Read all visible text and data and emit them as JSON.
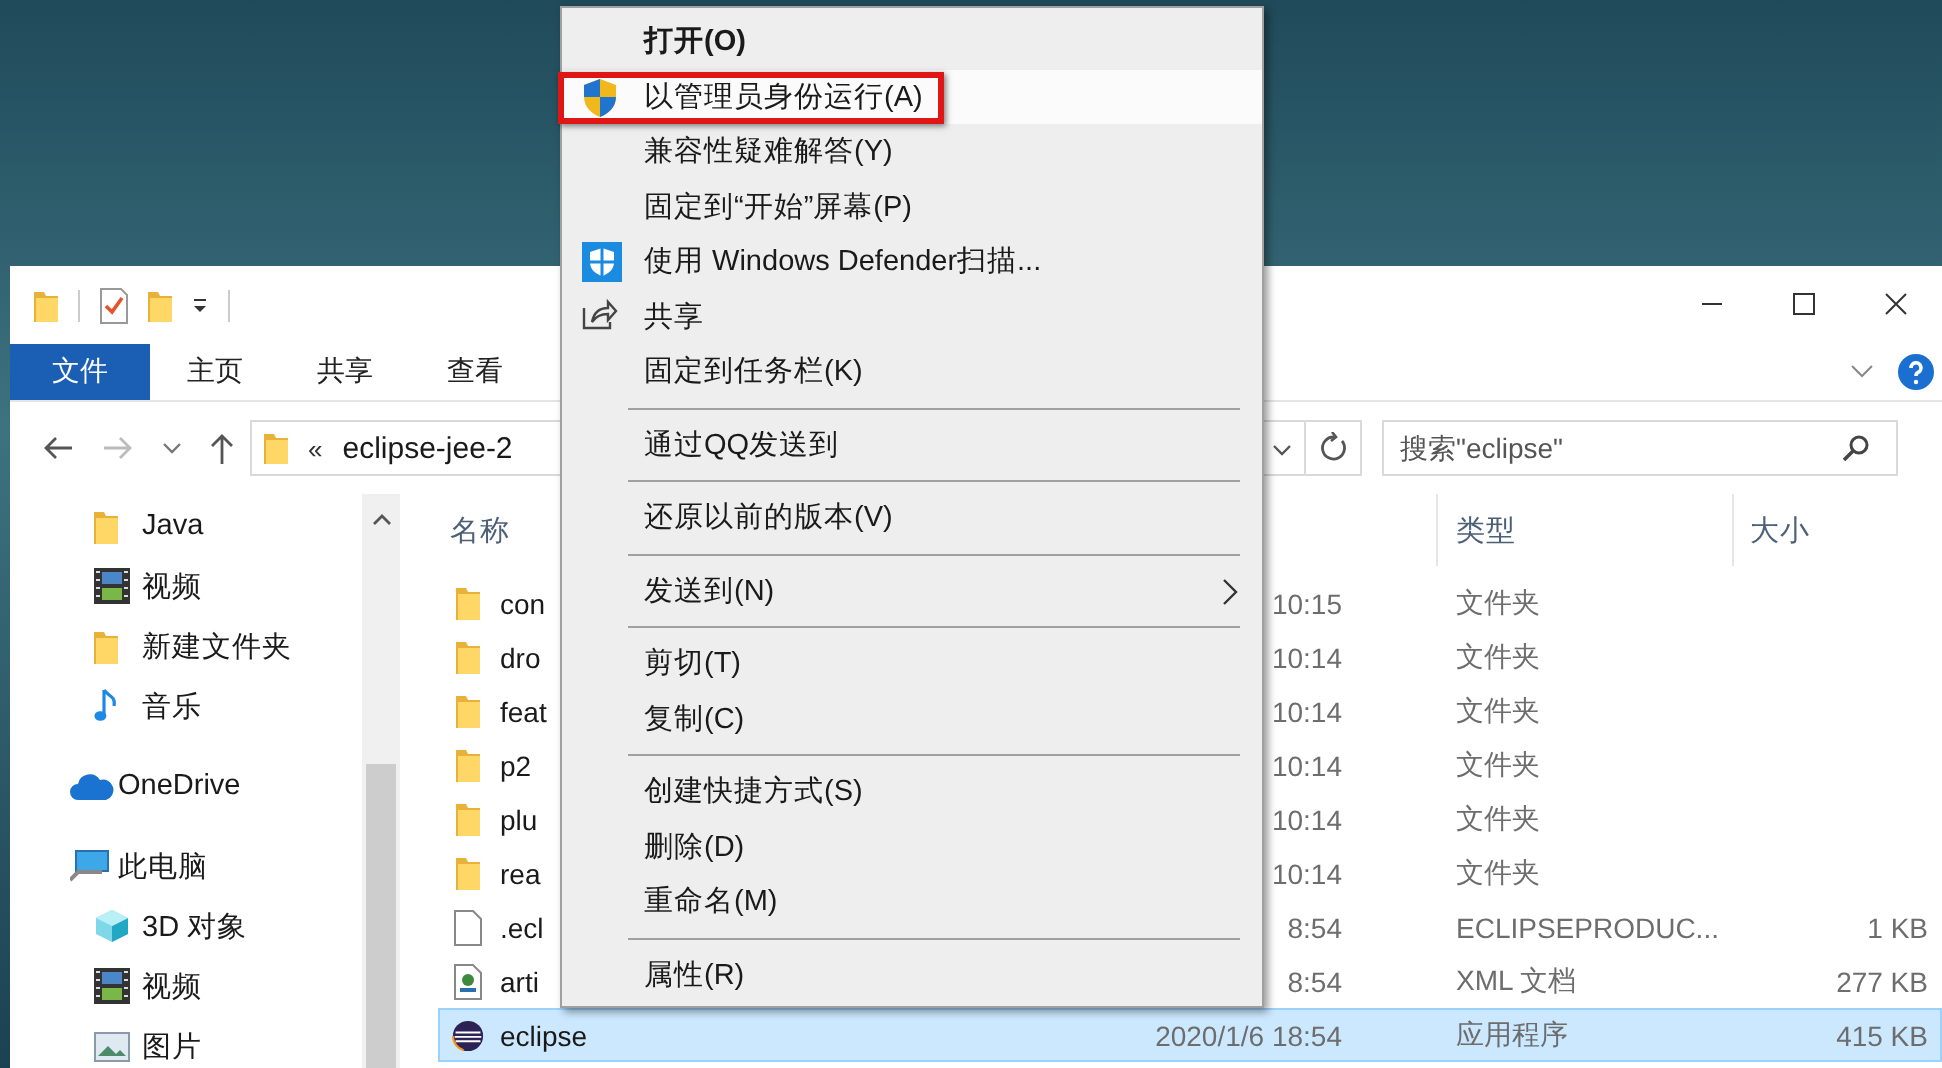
{
  "ribbon_tabs": [
    {
      "label": "文件",
      "kind": "file"
    },
    {
      "label": "主页",
      "kind": "tab"
    },
    {
      "label": "共享",
      "kind": "tab"
    },
    {
      "label": "查看",
      "kind": "tab"
    }
  ],
  "address_bar": {
    "overflow": "«",
    "path": "eclipse-jee-2"
  },
  "search": {
    "placeholder": "搜索\"eclipse\""
  },
  "nav_pane": {
    "quick_access": [
      {
        "label": "Java",
        "kind": "folder"
      },
      {
        "label": "视频",
        "kind": "video"
      },
      {
        "label": "新建文件夹",
        "kind": "folder"
      },
      {
        "label": "音乐",
        "kind": "music"
      }
    ],
    "locations": [
      {
        "label": "OneDrive",
        "kind": "cloud"
      },
      {
        "label": "此电脑",
        "kind": "pc",
        "children": [
          {
            "label": "3D 对象",
            "kind": "cube"
          },
          {
            "label": "视频",
            "kind": "video"
          },
          {
            "label": "图片",
            "kind": "picture"
          }
        ]
      }
    ]
  },
  "file_list": {
    "columns": [
      {
        "label": "名称"
      },
      {
        "label": "类型"
      },
      {
        "label": "大小"
      }
    ],
    "rows": [
      {
        "name": "con",
        "date": "10:15",
        "type": "文件夹",
        "kind": "folder",
        "selected": false
      },
      {
        "name": "dro",
        "date": "10:14",
        "type": "文件夹",
        "kind": "folder",
        "selected": false
      },
      {
        "name": "feat",
        "date": "10:14",
        "type": "文件夹",
        "kind": "folder",
        "selected": false
      },
      {
        "name": "p2",
        "date": "10:14",
        "type": "文件夹",
        "kind": "folder",
        "selected": false
      },
      {
        "name": "plu",
        "date": "10:14",
        "type": "文件夹",
        "kind": "folder",
        "selected": false
      },
      {
        "name": "rea",
        "date": "10:14",
        "type": "文件夹",
        "kind": "folder",
        "selected": false
      },
      {
        "name": ".ecl",
        "date": "8:54",
        "type": "ECLIPSEPRODUC...",
        "size": "1 KB",
        "kind": "file",
        "selected": false
      },
      {
        "name": "arti",
        "date": "8:54",
        "type": "XML 文档",
        "size": "277 KB",
        "kind": "xml",
        "selected": false
      },
      {
        "name": "eclipse",
        "date": "2020/1/6 18:54",
        "type": "应用程序",
        "size": "415 KB",
        "kind": "app",
        "selected": true
      }
    ]
  },
  "context_menu": {
    "items": [
      {
        "kind": "item",
        "label": "打开(O)",
        "default": true,
        "selected": false,
        "submenu": false,
        "framed": false
      },
      {
        "kind": "admin",
        "label": "以管理员身份运行(A)",
        "default": false,
        "selected": true,
        "submenu": false,
        "framed": true
      },
      {
        "kind": "item",
        "label": "兼容性疑难解答(Y)",
        "default": false,
        "selected": false,
        "submenu": false,
        "framed": false
      },
      {
        "kind": "item",
        "label": "固定到“开始”屏幕(P)",
        "default": false,
        "selected": false,
        "submenu": false,
        "framed": false
      },
      {
        "kind": "scan",
        "label": "使用 Windows Defender扫描...",
        "default": false,
        "selected": false,
        "submenu": false,
        "framed": false
      },
      {
        "kind": "share",
        "label": "共享",
        "default": false,
        "selected": false,
        "submenu": false,
        "framed": false
      },
      {
        "kind": "item",
        "label": "固定到任务栏(K)",
        "default": false,
        "selected": false,
        "submenu": false,
        "framed": false
      },
      {
        "kind": "separator"
      },
      {
        "kind": "item",
        "label": "通过QQ发送到",
        "default": false,
        "selected": false,
        "submenu": false,
        "framed": false
      },
      {
        "kind": "separator"
      },
      {
        "kind": "item",
        "label": "还原以前的版本(V)",
        "default": false,
        "selected": false,
        "submenu": false,
        "framed": false
      },
      {
        "kind": "separator"
      },
      {
        "kind": "item",
        "label": "发送到(N)",
        "default": false,
        "selected": false,
        "submenu": true,
        "framed": false
      },
      {
        "kind": "separator"
      },
      {
        "kind": "item",
        "label": "剪切(T)",
        "default": false,
        "selected": false,
        "submenu": false,
        "framed": false
      },
      {
        "kind": "item",
        "label": "复制(C)",
        "default": false,
        "selected": false,
        "submenu": false,
        "framed": false
      },
      {
        "kind": "separator"
      },
      {
        "kind": "item",
        "label": "创建快捷方式(S)",
        "default": false,
        "selected": false,
        "submenu": false,
        "framed": false
      },
      {
        "kind": "item",
        "label": "删除(D)",
        "default": false,
        "selected": false,
        "submenu": false,
        "framed": false
      },
      {
        "kind": "item",
        "label": "重命名(M)",
        "default": false,
        "selected": false,
        "submenu": false,
        "framed": false
      },
      {
        "kind": "separator"
      },
      {
        "kind": "item",
        "label": "属性(R)",
        "default": false,
        "selected": false,
        "submenu": false,
        "framed": false
      }
    ]
  }
}
